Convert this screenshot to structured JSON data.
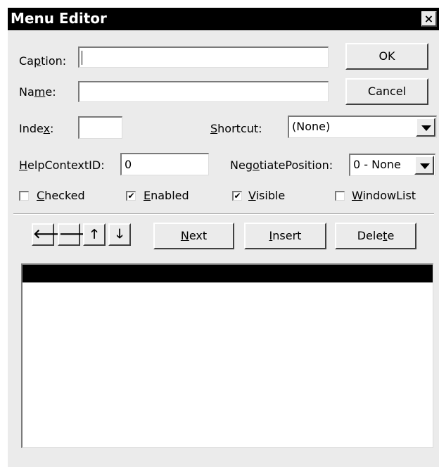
{
  "window": {
    "title": "Menu Editor",
    "close_glyph": "×"
  },
  "labels": {
    "caption": {
      "pre": "Ca",
      "key": "p",
      "post": "tion:"
    },
    "name": {
      "pre": "Na",
      "key": "m",
      "post": "e:"
    },
    "index": {
      "pre": "Inde",
      "key": "x",
      "post": ":"
    },
    "shortcut": {
      "pre": "",
      "key": "S",
      "post": "hortcut:"
    },
    "helpcontextid": {
      "pre": "",
      "key": "H",
      "post": "elpContextID:"
    },
    "negotiateposition": {
      "pre": "Neg",
      "key": "o",
      "post": "tiatePosition:"
    }
  },
  "fields": {
    "caption_value": "",
    "name_value": "",
    "index_value": "",
    "helpcontextid_value": "0"
  },
  "shortcut": {
    "selected": "(None)"
  },
  "negotiate": {
    "selected": "0 - None"
  },
  "buttons": {
    "ok": "OK",
    "cancel": "Cancel",
    "next": {
      "pre": "",
      "key": "N",
      "post": "ext"
    },
    "insert": {
      "pre": "",
      "key": "I",
      "post": "nsert"
    },
    "delete": {
      "pre": "Dele",
      "key": "t",
      "post": "e"
    }
  },
  "checkboxes": {
    "checked": {
      "pre": "",
      "key": "C",
      "post": "hecked",
      "state": ""
    },
    "enabled": {
      "pre": "",
      "key": "E",
      "post": "nabled",
      "state": "✔"
    },
    "visible": {
      "pre": "",
      "key": "V",
      "post": "isible",
      "state": "✔"
    },
    "windowlist": {
      "pre": "",
      "key": "W",
      "post": "indowList",
      "state": ""
    }
  },
  "arrows": {
    "left": "🡐",
    "right": "🡒",
    "up": "🡑",
    "down": "🡓"
  },
  "colors": {
    "titlebar": "#000000",
    "dialog_bg": "#ebebeb",
    "selection": "#000000"
  }
}
